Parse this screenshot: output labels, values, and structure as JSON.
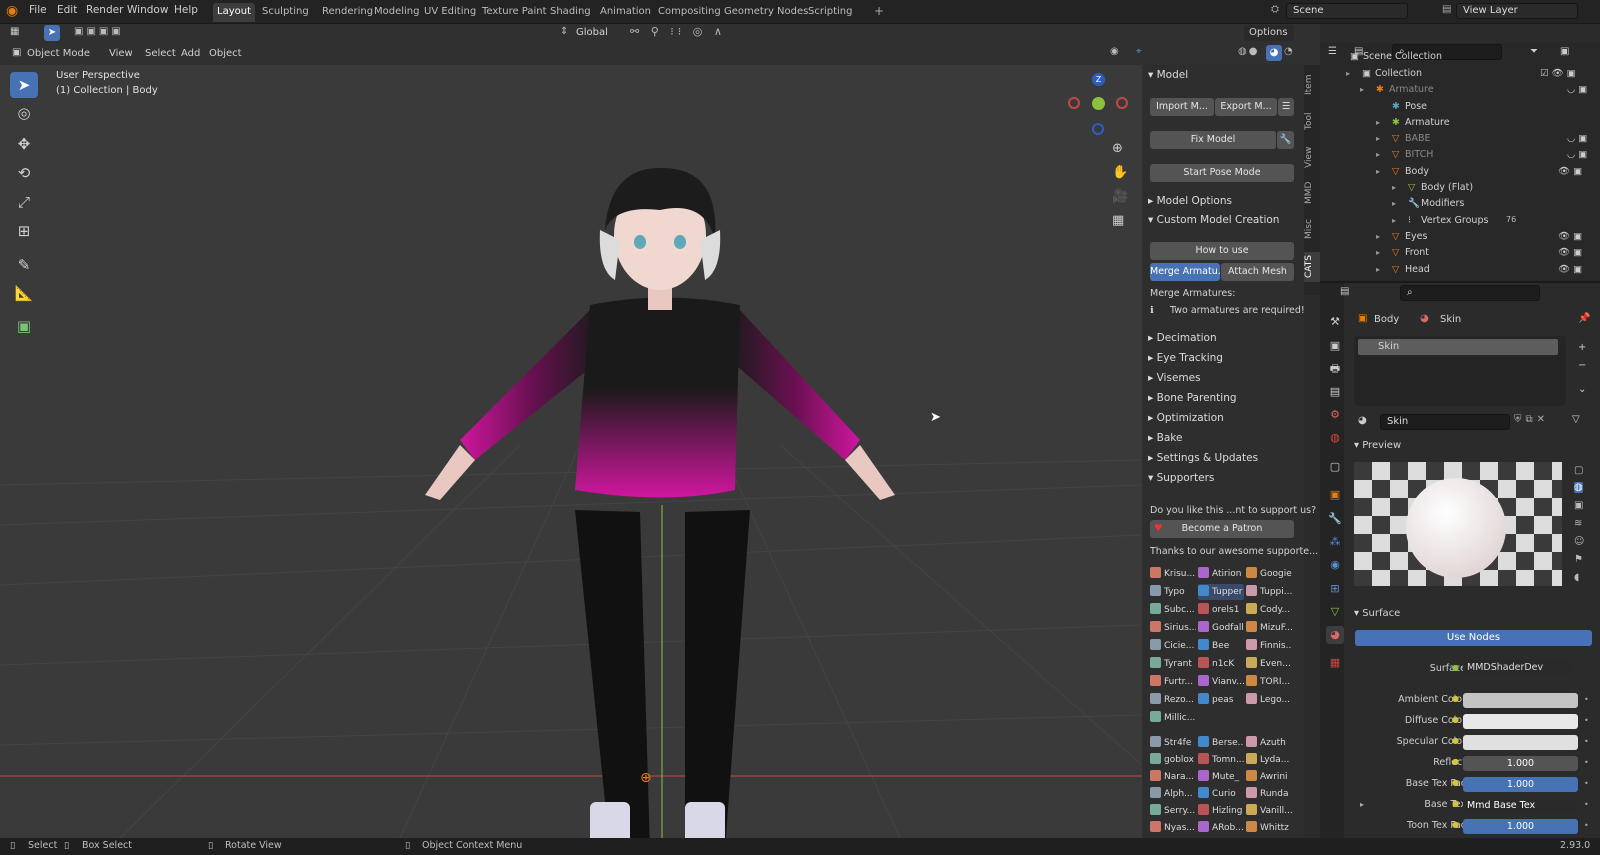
{
  "menu": {
    "file": "File",
    "edit": "Edit",
    "render": "Render",
    "window": "Window",
    "help": "Help"
  },
  "workspaces": [
    "Layout",
    "Sculpting",
    "Rendering",
    "Modeling",
    "UV Editing",
    "Texture Paint",
    "Shading",
    "Animation",
    "Compositing",
    "Geometry Nodes",
    "Scripting"
  ],
  "scene": {
    "label": "Scene",
    "view_layer": "View Layer"
  },
  "toolbar": {
    "orientation": "Global",
    "options": "Options"
  },
  "viewport_header": {
    "mode": "Object Mode",
    "view": "View",
    "select": "Select",
    "add": "Add",
    "object": "Object"
  },
  "viewport": {
    "perspective": "User Perspective",
    "collection": "(1) Collection | Body",
    "gizmo_z": "Z"
  },
  "npanel_tabs": [
    "Item",
    "Tool",
    "View",
    "MMD",
    "Misc",
    "CATS"
  ],
  "cats": {
    "model": "Model",
    "import": "Import M...",
    "export": "Export M...",
    "fix_model": "Fix Model",
    "start_pose": "Start Pose Mode",
    "model_options": "Model Options",
    "custom_creation": "Custom Model Creation",
    "how_to_use": "How to use",
    "merge_armature": "Merge Armatu...",
    "attach_mesh": "Attach Mesh",
    "merge_armatures_label": "Merge Armatures:",
    "two_armatures": "Two armatures are required!",
    "sections": [
      "Decimation",
      "Eye Tracking",
      "Visemes",
      "Bone Parenting",
      "Optimization",
      "Bake",
      "Settings & Updates",
      "Supporters"
    ],
    "support_q": "Do you like this ...nt to support us?",
    "become_patron": "Become a Patron",
    "thanks": "Thanks to our awesome supporte...",
    "supporters": [
      "Krisu...",
      "Atirion",
      "Googie",
      "Typo",
      "Tupper",
      "Tuppi...",
      "Subc...",
      "orels1",
      "Cody...",
      "Sirius...",
      "Godfall",
      "MizuF...",
      "Cicie...",
      "Bee",
      "Finnis...",
      "Tyrant",
      "n1cK",
      "Even...",
      "Furtr...",
      "Vianv...",
      "TORI...",
      "Rezo...",
      "peas",
      "Lego...",
      "Millic..."
    ],
    "supporters2": [
      "Str4fe",
      "Berse...",
      "Azuth",
      "goblox",
      "Tomn...",
      "Lyda...",
      "Nara...",
      "Mute_",
      "Awrini",
      "Alph...",
      "Curio",
      "Runda",
      "Serry...",
      "Hizling",
      "Vanill...",
      "Nyas...",
      "ARob...",
      "Whittz"
    ]
  },
  "outliner": {
    "scene_collection": "Scene Collection",
    "collection": "Collection",
    "armature_obj": "Armature",
    "pose": "Pose",
    "armature": "Armature",
    "babe": "BABE",
    "bitch": "BITCH",
    "body": "Body",
    "body_flat": "Body (Flat)",
    "modifiers": "Modifiers",
    "vertex_groups": "Vertex Groups",
    "vg_count": "76",
    "eyes": "Eyes",
    "front": "Front",
    "head": "Head"
  },
  "properties": {
    "breadcrumb_obj": "Body",
    "breadcrumb_mat": "Skin",
    "slot": "Skin",
    "material_name": "Skin",
    "preview": "Preview",
    "surface_section": "Surface",
    "use_nodes": "Use Nodes",
    "surface_label": "Surface",
    "surface_value": "MMDShaderDev",
    "ambient": "Ambient Color",
    "diffuse": "Diffuse Color",
    "specular": "Specular Color",
    "reflect": "Reflect",
    "reflect_val": "1.000",
    "base_tex_fac": "Base Tex Fac",
    "base_tex_fac_val": "1.000",
    "base_tex": "Base Tex",
    "base_tex_val": "Mmd Base Tex",
    "toon_tex_fac": "Toon Tex Fac",
    "toon_tex_fac_val": "1.000"
  },
  "status": {
    "select": "Select",
    "box_select": "Box Select",
    "rotate_view": "Rotate View",
    "context_menu": "Object Context Menu",
    "version": "2.93.0"
  },
  "colors": {
    "accent": "#4772b3",
    "magenta": "#d0169e",
    "xaxis": "#c44747",
    "yaxis": "#8dc03c"
  }
}
